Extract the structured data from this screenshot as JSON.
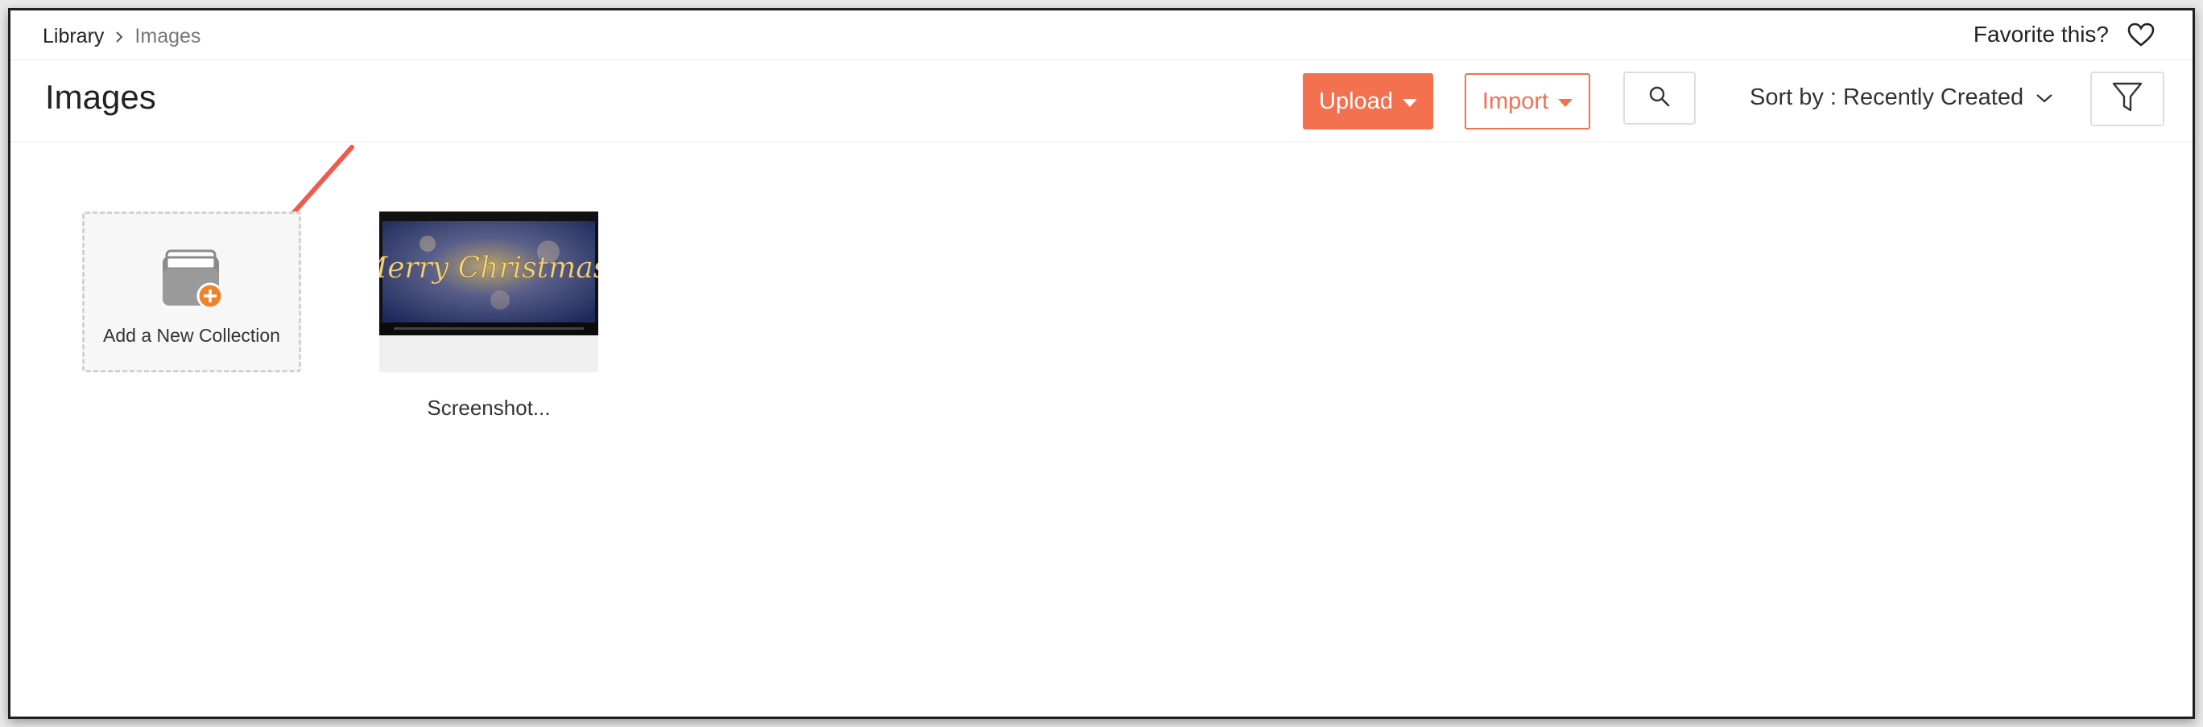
{
  "breadcrumb": {
    "root": "Library",
    "current": "Images"
  },
  "favorite": {
    "label": "Favorite this?",
    "icon": "heart-outline-icon"
  },
  "header": {
    "title": "Images",
    "upload_label": "Upload",
    "import_label": "Import",
    "sort_label": "Sort by : Recently Created"
  },
  "collection_card": {
    "label": "Add a New Collection"
  },
  "images": [
    {
      "label": "Screenshot...",
      "thumbnail_text": "Merry Christmas!"
    }
  ],
  "colors": {
    "accent": "#f4714f",
    "add_badge": "#f0822a",
    "annotation_arrow": "#ef5b4f"
  }
}
